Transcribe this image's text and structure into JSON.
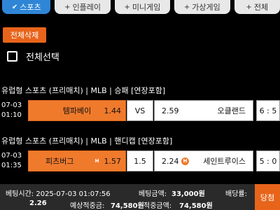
{
  "tabs": [
    {
      "label": "스포츠",
      "icon": "check-icon",
      "active": true
    },
    {
      "label": "인플레이",
      "icon": "plus-icon",
      "active": false
    },
    {
      "label": "미니게임",
      "icon": "plus-icon",
      "active": false
    },
    {
      "label": "가상게임",
      "icon": "plus-icon",
      "active": false
    },
    {
      "label": "전체",
      "icon": "plus-icon",
      "active": false
    }
  ],
  "delete_all_label": "전체삭제",
  "select_all_label": "전체선택",
  "bets": [
    {
      "title": "유럽형 스포츠 (프리매치) | MLB | 승패 [연장포함]",
      "date": "07-03",
      "time": "01:10",
      "home_team": "템파베이",
      "home_odds": "1.44",
      "middle": "VS",
      "away_odds": "2.59",
      "away_team": "오클랜드",
      "score": "6 : 5"
    },
    {
      "title": "유럽형 스포츠 (프리매치) | MLB | 핸디캡 [연장포함]",
      "date": "07-03",
      "time": "01:35",
      "home_team": "피츠버그",
      "home_badge": "H",
      "home_odds": "1.57",
      "middle": "1.5",
      "away_odds": "2.24",
      "away_badge": "H",
      "away_team": "세인트루이스",
      "score": "5 : 0"
    }
  ],
  "footer": {
    "bet_time_label": "베팅시간: 2025-07-03 01:07:56",
    "bet_amount_label": "베팅금액:",
    "bet_amount_value": "33,000원",
    "odds_label": "배당률:",
    "odds_value": "2.26",
    "expected_label": "예상적중금:",
    "expected_value": "74,580원",
    "win_label": "적중금액:",
    "win_value": "74,580원",
    "result_label": "당첨"
  }
}
